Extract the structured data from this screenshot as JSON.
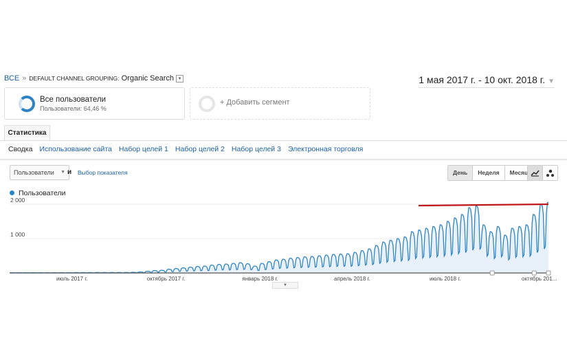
{
  "breadcrumb": {
    "root": "ВСЕ",
    "sep": "»",
    "prefix": "DEFAULT CHANNEL GROUPING:",
    "value": "Organic Search",
    "dropdown": "▾"
  },
  "date_range": {
    "label": "1 мая 2017 г. - 10 окт. 2018 г.",
    "caret": "▼"
  },
  "segments": [
    {
      "title": "Все пользователи",
      "subtitle": "Пользователи: 64,46 %"
    },
    {
      "title": "+ Добавить сегмент"
    }
  ],
  "tab": "Статистика",
  "subnav": [
    "Сводка",
    "Использование сайта",
    "Набор целей 1",
    "Набор целей 2",
    "Набор целей 3",
    "Электронная торговля"
  ],
  "metric_select": {
    "value": "Пользователи",
    "caret": "▼"
  },
  "and_label": "и",
  "pick_metric": "Выбор показателя",
  "granularity": [
    "День",
    "Неделя",
    "Месяц"
  ],
  "colors": {
    "accent": "#2d84c4",
    "fill": "#e8f1fa",
    "annotation": "#c0171d"
  },
  "chart_data": {
    "type": "area",
    "legend": "Пользователи",
    "x_start": "2017-05-01",
    "x_end": "2018-10-10",
    "granularity": "day",
    "yticks": [
      {
        "v": 1000,
        "label": "1 000"
      },
      {
        "v": 2000,
        "label": "2 000"
      }
    ],
    "ylim": [
      0,
      2100
    ],
    "xticks": [
      {
        "day": 61,
        "label": "июль 2017 г."
      },
      {
        "day": 153,
        "label": "октябрь 2017 г."
      },
      {
        "day": 245,
        "label": "январь 2018 г."
      },
      {
        "day": 335,
        "label": "апрель 2018 г."
      },
      {
        "day": 426,
        "label": "июль 2018 г."
      },
      {
        "day": 518,
        "label": "октябрь 201..."
      }
    ],
    "weekly_peak": [
      8,
      8,
      9,
      9,
      10,
      10,
      10,
      11,
      11,
      12,
      12,
      12,
      13,
      13,
      14,
      14,
      15,
      20,
      30,
      50,
      70,
      80,
      110,
      130,
      150,
      170,
      190,
      200,
      230,
      250,
      260,
      280,
      300,
      270,
      200,
      280,
      330,
      380,
      400,
      430,
      450,
      470,
      480,
      500,
      520,
      540,
      550,
      560,
      600,
      650,
      700,
      800,
      900,
      950,
      1000,
      1050,
      1200,
      1250,
      1300,
      1350,
      1400,
      1500,
      1600,
      1700,
      1900,
      1950,
      1400,
      1200,
      1350,
      1100,
      1300,
      1350,
      1400,
      1700,
      2000,
      2050
    ],
    "weekend_ratio": 0.35,
    "annotation_line": {
      "from_day": 400,
      "to_day": 527,
      "value": 2000
    },
    "annotation_markers_days": [
      472,
      513,
      527
    ]
  }
}
